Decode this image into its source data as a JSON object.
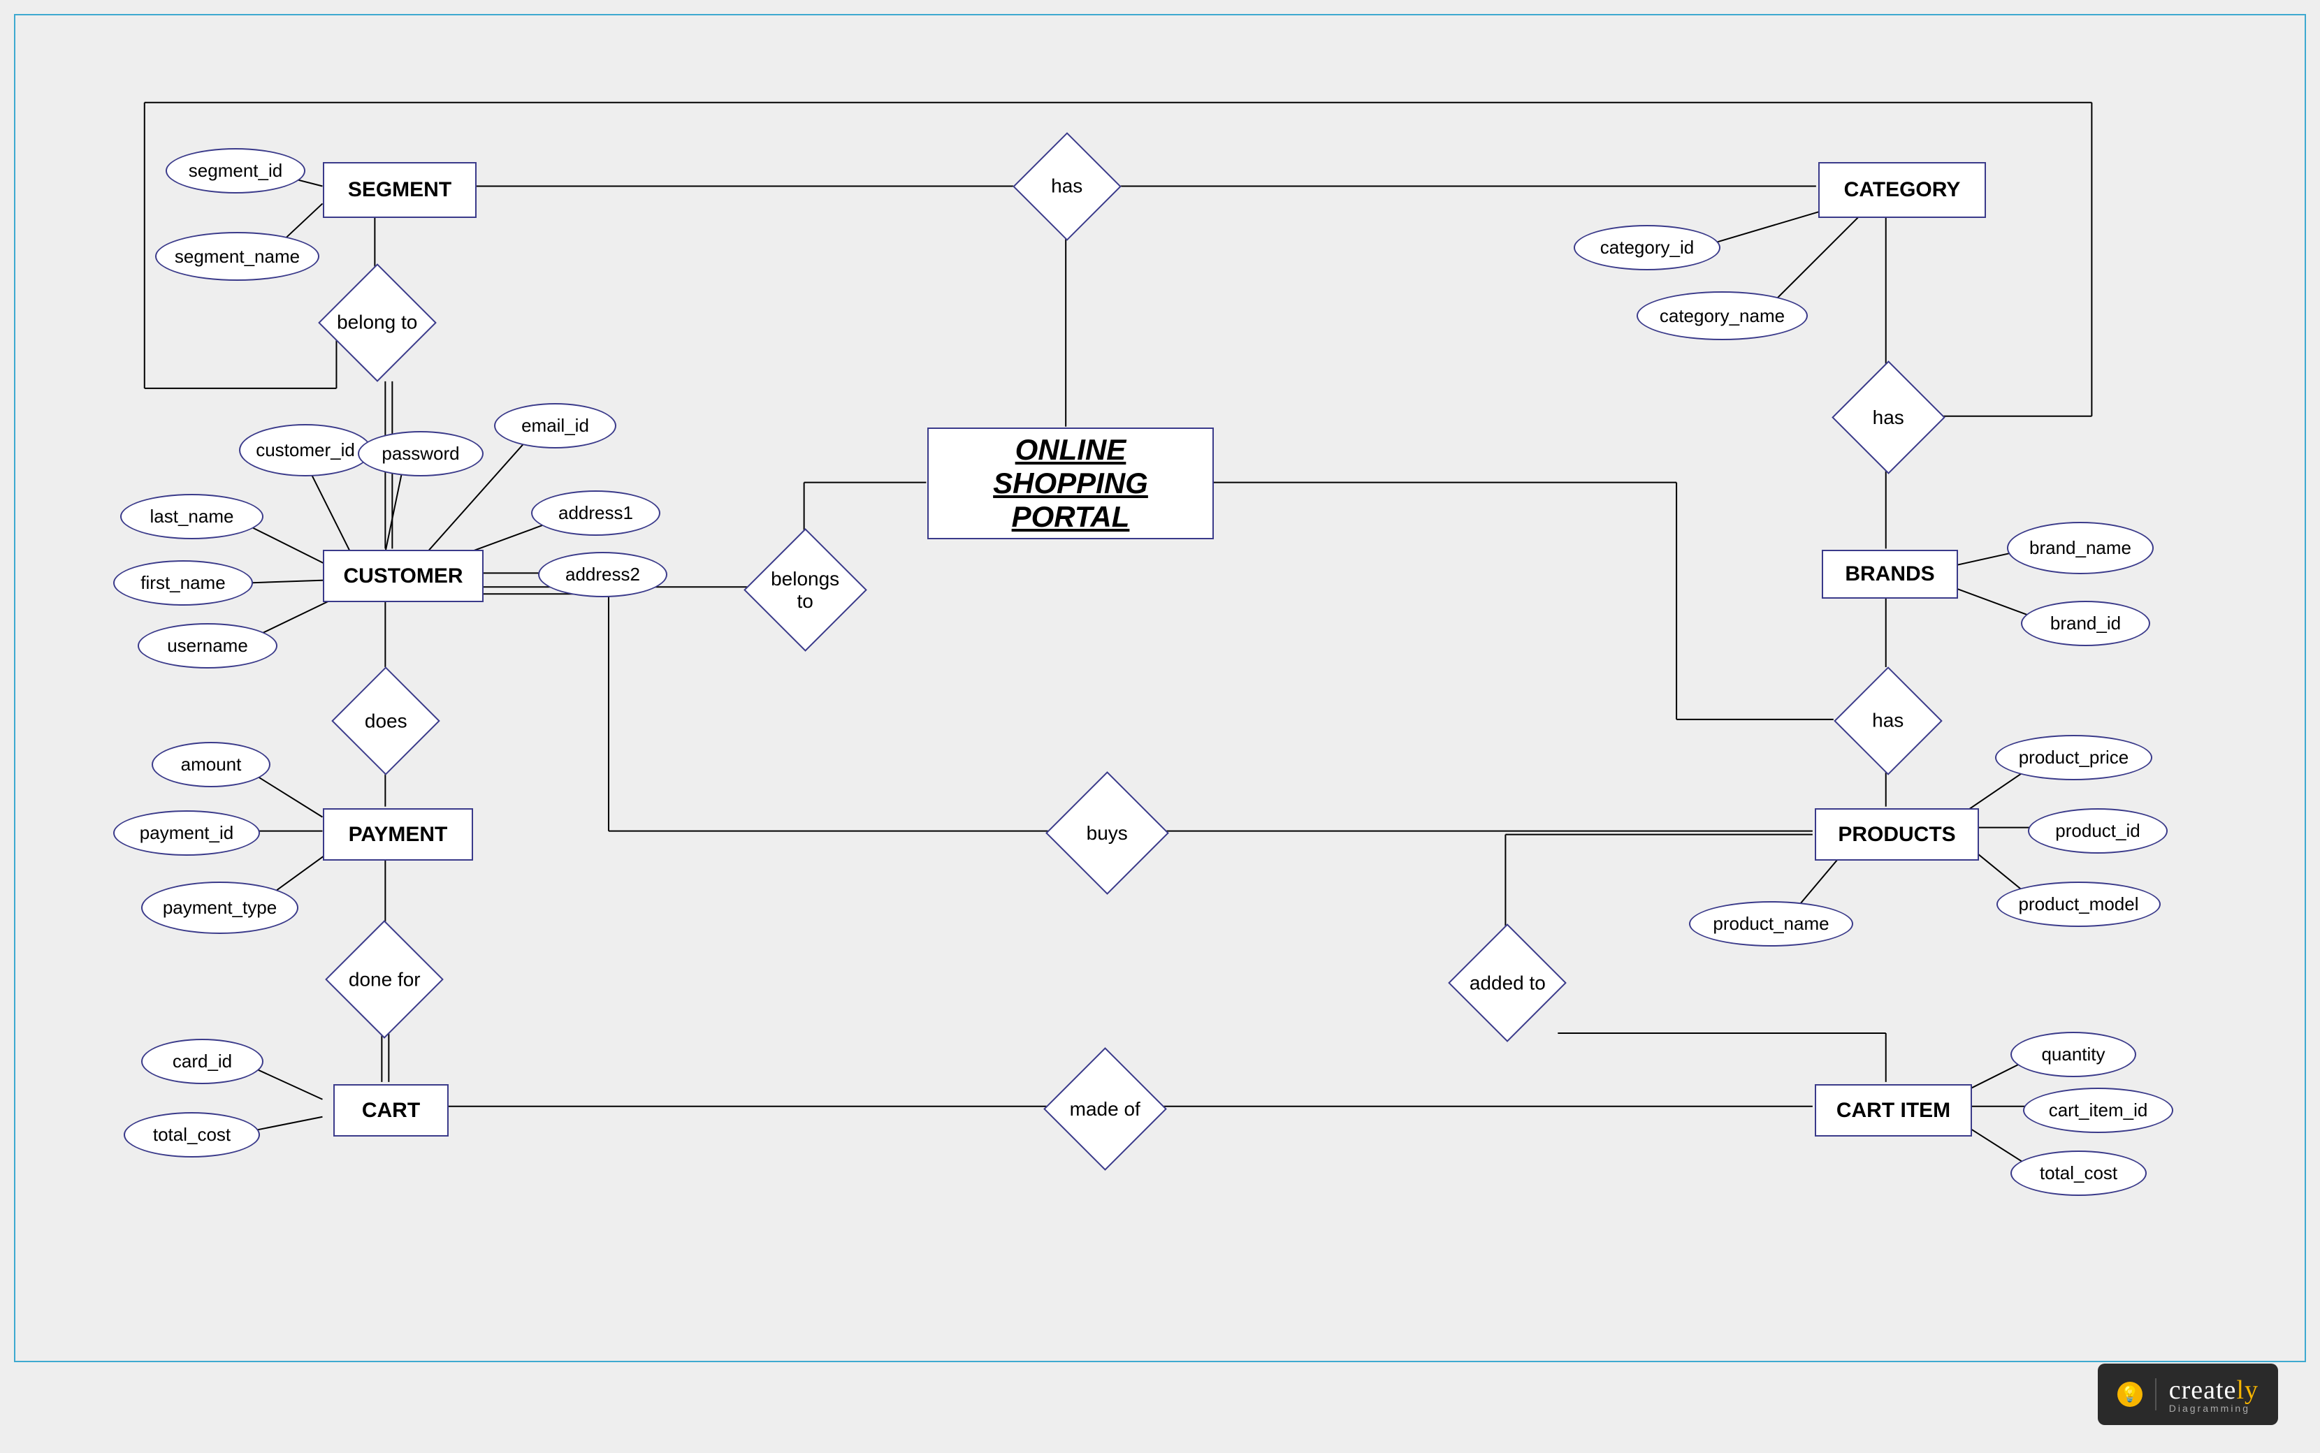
{
  "diagram": {
    "title": "ONLINE SHOPPING PORTAL",
    "type": "Entity-Relationship Diagram"
  },
  "entities": {
    "segment": "SEGMENT",
    "category": "CATEGORY",
    "customer": "CUSTOMER",
    "brands": "BRANDS",
    "payment": "PAYMENT",
    "products": "PRODUCTS",
    "cart": "CART",
    "cart_item": "CART ITEM"
  },
  "attributes": {
    "segment_id": "segment_id",
    "segment_name": "segment_name",
    "category_id": "category_id",
    "category_name": "category_name",
    "customer_id": "customer_id",
    "password": "password",
    "email_id": "email_id",
    "last_name": "last_name",
    "address1": "address1",
    "first_name": "first_name",
    "address2": "address2",
    "username": "username",
    "brand_name": "brand_name",
    "brand_id": "brand_id",
    "amount": "amount",
    "payment_id": "payment_id",
    "payment_type": "payment_type",
    "product_price": "product_price",
    "product_id": "product_id",
    "product_model": "product_model",
    "product_name": "product_name",
    "card_id": "card_id",
    "total_cost": "total_cost",
    "quantity": "quantity",
    "cart_item_id": "cart_item_id",
    "ci_total_cost": "total_cost"
  },
  "relationships": {
    "has_top": "has",
    "belong_to": "belong to",
    "has_catbrand": "has",
    "belongs_to": "belongs to",
    "does": "does",
    "has_brandprod": "has",
    "buys": "buys",
    "done_for": "done for",
    "added_to": "added to",
    "made_of": "made of"
  },
  "branding": {
    "name_a": "create",
    "name_b": "ly",
    "tagline": "Diagramming"
  }
}
